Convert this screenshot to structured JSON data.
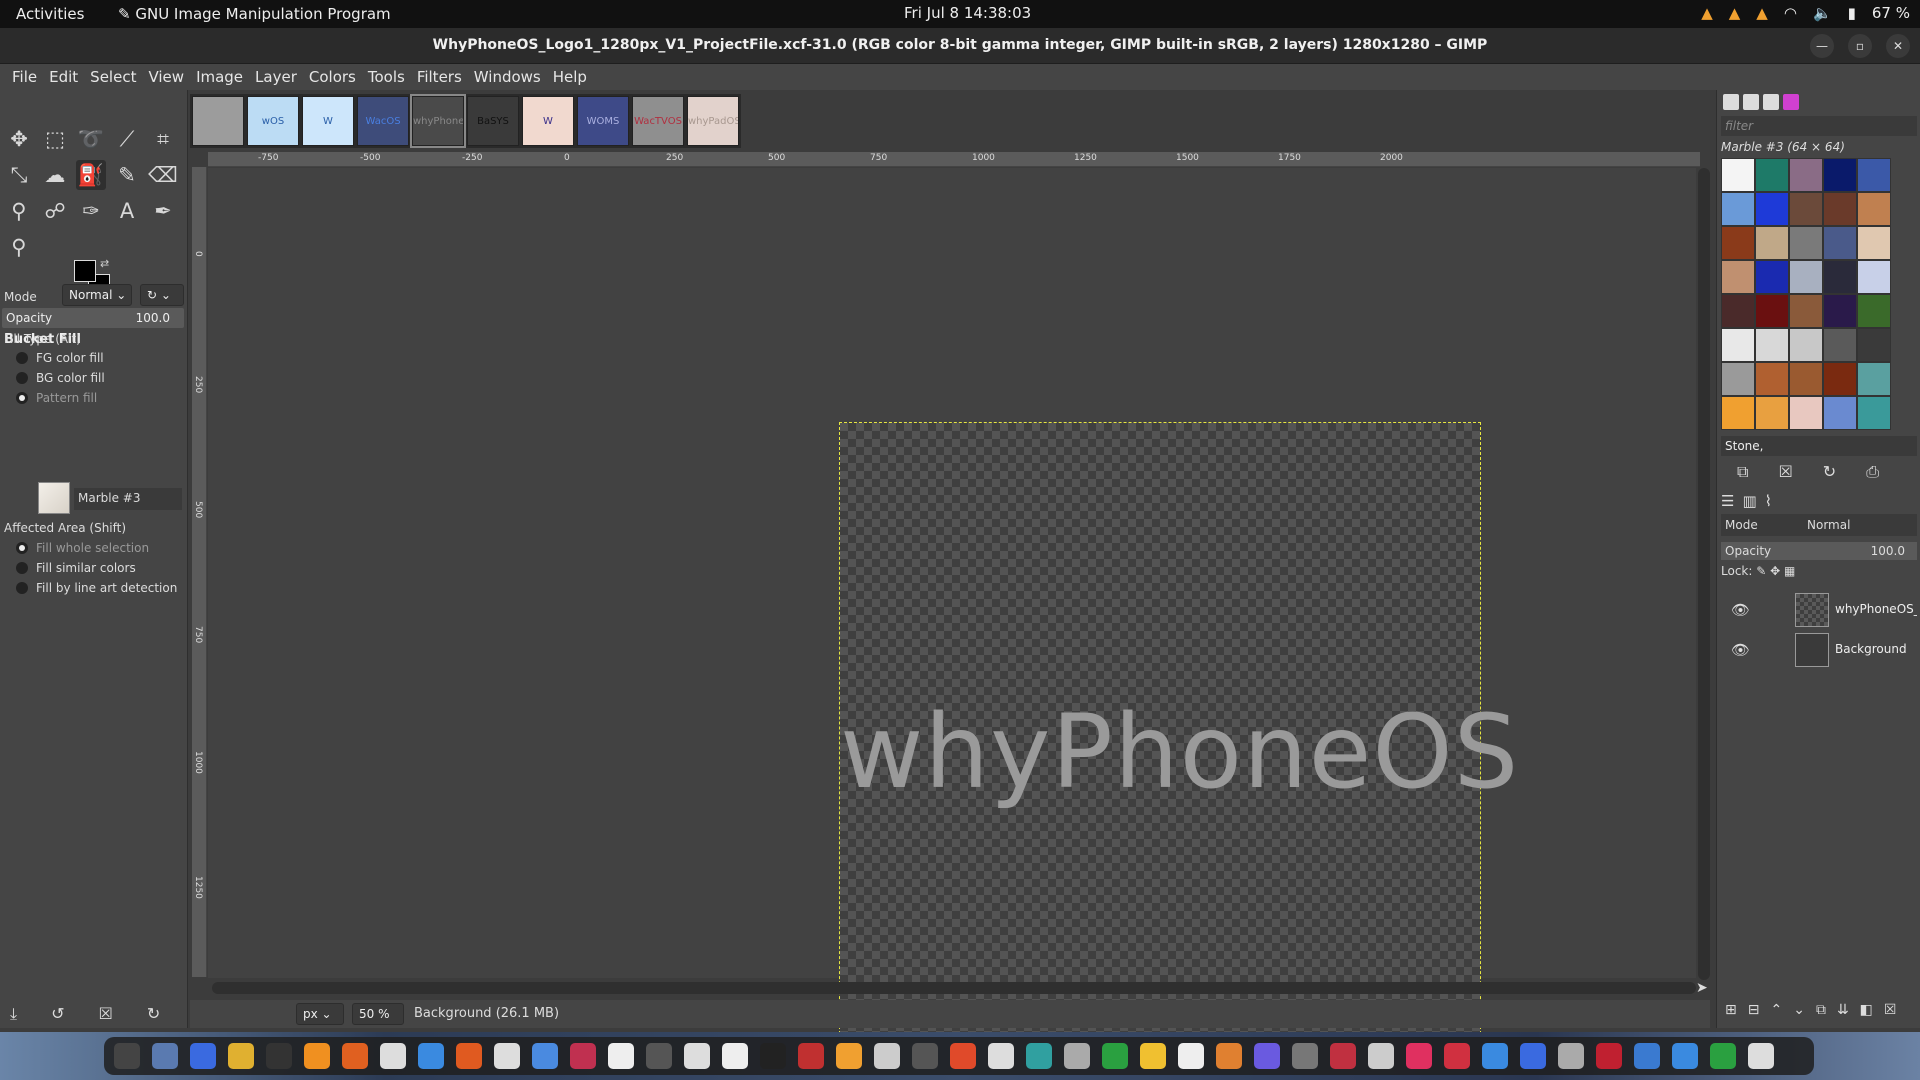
{
  "topbar": {
    "activities": "Activities",
    "app_name": "GNU Image Manipulation Program",
    "clock": "Fri Jul 8  14:38:03",
    "battery": "67 %"
  },
  "window": {
    "title": "WhyPhoneOS_Logo1_1280px_V1_ProjectFile.xcf-31.0 (RGB color 8-bit gamma integer, GIMP built-in sRGB, 2 layers) 1280x1280 – GIMP"
  },
  "menubar": [
    "File",
    "Edit",
    "Select",
    "View",
    "Image",
    "Layer",
    "Colors",
    "Tools",
    "Filters",
    "Windows",
    "Help"
  ],
  "toolbox": {
    "tool_options_title": "Bucket Fill",
    "mode_label": "Mode",
    "mode_value": "Normal",
    "opacity_label": "Opacity",
    "opacity_value": "100.0",
    "fill_type_label": "Fill Type  (Alt)",
    "fill_types": [
      "FG color fill",
      "BG color fill",
      "Pattern fill"
    ],
    "selected_fill_type": "Pattern fill",
    "pattern_name": "Marble #3",
    "affected_area_label": "Affected Area  (Shift)",
    "affected_areas": [
      "Fill whole selection",
      "Fill similar colors",
      "Fill by line art detection"
    ],
    "selected_affected_area": "Fill whole selection",
    "fg_color": "#000000",
    "bg_color": "#000000"
  },
  "image_tabs": [
    {
      "label": "",
      "bg": "#9c9c9c",
      "fg": "#cccccc"
    },
    {
      "label": "wOS",
      "bg": "#bcdcf4",
      "fg": "#2a5fa8"
    },
    {
      "label": "W",
      "bg": "#cde6fb",
      "fg": "#2a5fa8"
    },
    {
      "label": "WacOS",
      "bg": "#3e4c7a",
      "fg": "#4a7fe0"
    },
    {
      "label": "whyPhoneOS",
      "bg": "#4a4a4a",
      "fg": "#888888"
    },
    {
      "label": "BaSYS",
      "bg": "#3a3a3a",
      "fg": "#111111"
    },
    {
      "label": "W",
      "bg": "#f1d9cf",
      "fg": "#3a2f8a"
    },
    {
      "label": "WOMS",
      "bg": "#3e4a88",
      "fg": "#aab0e0"
    },
    {
      "label": "WacTVOS",
      "bg": "#8f8f8f",
      "fg": "#b03040"
    },
    {
      "label": "whyPadOS",
      "bg": "#e2d2cc",
      "fg": "#a89890"
    }
  ],
  "rulers": {
    "h_labels": [
      "-750",
      "-500",
      "-250",
      "0",
      "250",
      "500",
      "750",
      "1000",
      "1250",
      "1500",
      "1750",
      "2000"
    ],
    "v_labels": [
      "0",
      "250",
      "500",
      "750",
      "1000",
      "1250"
    ]
  },
  "canvas": {
    "logo_text": "whyPhoneOS"
  },
  "status": {
    "unit": "px",
    "zoom": "50 %",
    "message": "Background (26.1 MB)"
  },
  "patterns_panel": {
    "filter_placeholder": "filter",
    "selected_label": "Marble #3 (64 × 64)",
    "tag": "Stone,",
    "swatches": [
      "#f4f4f4",
      "#1e7a68",
      "#8a6c86",
      "#0a1a6a",
      "#3b59a8",
      "#6a9ad8",
      "#1e3ad8",
      "#6b4a3a",
      "#6a3a2a",
      "#c08050",
      "#8a3a1a",
      "#c0a888",
      "#7a7a7a",
      "#4a5a8a",
      "#e0c8b0",
      "#c09070",
      "#1a2ab0",
      "#a8b0c0",
      "#2a2a3a",
      "#c8d0e8",
      "#4a2a2a",
      "#6a1010",
      "#8a5a3a",
      "#2a1a4a",
      "#3a6a2a",
      "#e8e8e8",
      "#d8d8d8",
      "#c8c8c8",
      "#5a5a5a",
      "#3a3a3a",
      "#9a9a9a",
      "#b06030",
      "#9a5a30",
      "#7a2a10",
      "#5aa0a0",
      "#f0a030",
      "#e8a040",
      "#e8c8c0",
      "#6a8ad0",
      "#3a9a9a"
    ]
  },
  "layers_panel": {
    "mode_label": "Mode",
    "mode_value": "Normal",
    "opacity_label": "Opacity",
    "opacity_value": "100.0",
    "lock_label": "Lock:",
    "layers": [
      {
        "name": "whyPhoneOS_"
      },
      {
        "name": "Background"
      }
    ]
  },
  "taskbar_icon_colors": [
    "#444",
    "#5a7ab0",
    "#3a6ae0",
    "#e0b030",
    "#333",
    "#f09020",
    "#e06020",
    "#ddd",
    "#3a8ae0",
    "#e05a20",
    "#ddd",
    "#4a8ae0",
    "#c03050",
    "#eee",
    "#555",
    "#ddd",
    "#eee",
    "#222",
    "#c03030",
    "#f0a030",
    "#ccc",
    "#555",
    "#e04a2a",
    "#ddd",
    "#30a0a0",
    "#aaa",
    "#2aa040",
    "#f0c030",
    "#eee",
    "#e08030",
    "#6a5ae0",
    "#777",
    "#c03040",
    "#ccc",
    "#e03060",
    "#d03040",
    "#3a8ae0",
    "#3a6ae0",
    "#aaa",
    "#c02030",
    "#3a7ad0",
    "#3a8ae0",
    "#2aa040",
    "#ddd"
  ]
}
